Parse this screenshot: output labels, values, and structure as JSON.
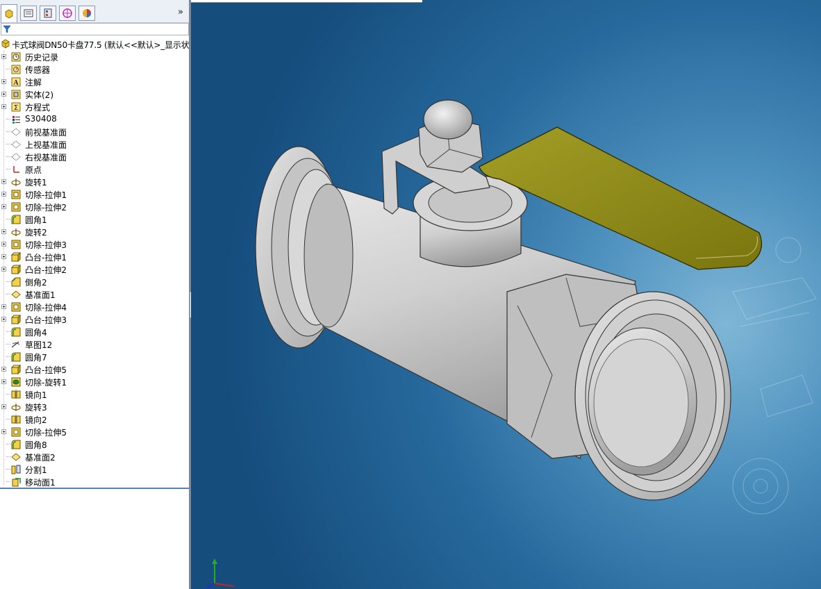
{
  "feature_manager": {
    "tabs": [
      {
        "name": "featuremanager-tab",
        "active": true
      },
      {
        "name": "propertymanager-tab",
        "active": false
      },
      {
        "name": "configurationmanager-tab",
        "active": false
      },
      {
        "name": "dimxpertmanager-tab",
        "active": false
      },
      {
        "name": "displaymanager-tab",
        "active": false
      }
    ],
    "expand_label": "»",
    "root_label": "卡式球阀DN50卡盘77.5  (默认<<默认>_显示状",
    "items": [
      {
        "label": "历史记录",
        "icon": "history-icon",
        "expandable": true
      },
      {
        "label": "传感器",
        "icon": "sensor-icon",
        "expandable": false
      },
      {
        "label": "注解",
        "icon": "annotation-icon",
        "expandable": true
      },
      {
        "label": "实体(2)",
        "icon": "solid-bodies-icon",
        "expandable": true
      },
      {
        "label": "方程式",
        "icon": "equations-icon",
        "expandable": true
      },
      {
        "label": "S30408",
        "icon": "material-icon",
        "expandable": false
      },
      {
        "label": "前视基准面",
        "icon": "plane-icon",
        "expandable": false
      },
      {
        "label": "上视基准面",
        "icon": "plane-icon",
        "expandable": false
      },
      {
        "label": "右视基准面",
        "icon": "plane-icon",
        "expandable": false
      },
      {
        "label": "原点",
        "icon": "origin-icon",
        "expandable": false
      },
      {
        "label": "旋转1",
        "icon": "revolve-icon",
        "expandable": true
      },
      {
        "label": "切除-拉伸1",
        "icon": "cut-extrude-icon",
        "expandable": true
      },
      {
        "label": "切除-拉伸2",
        "icon": "cut-extrude-icon",
        "expandable": true
      },
      {
        "label": "圆角1",
        "icon": "fillet-icon",
        "expandable": false
      },
      {
        "label": "旋转2",
        "icon": "revolve-icon",
        "expandable": true
      },
      {
        "label": "切除-拉伸3",
        "icon": "cut-extrude-icon",
        "expandable": true
      },
      {
        "label": "凸台-拉伸1",
        "icon": "boss-extrude-icon",
        "expandable": true
      },
      {
        "label": "凸台-拉伸2",
        "icon": "boss-extrude-icon",
        "expandable": true
      },
      {
        "label": "倒角2",
        "icon": "chamfer-icon",
        "expandable": false
      },
      {
        "label": "基准面1",
        "icon": "ref-plane-icon",
        "expandable": false
      },
      {
        "label": "切除-拉伸4",
        "icon": "cut-extrude-icon",
        "expandable": true
      },
      {
        "label": "凸台-拉伸3",
        "icon": "boss-extrude-icon",
        "expandable": true
      },
      {
        "label": "圆角4",
        "icon": "fillet-icon",
        "expandable": false
      },
      {
        "label": "草图12",
        "icon": "sketch-icon",
        "expandable": false
      },
      {
        "label": "圆角7",
        "icon": "fillet-icon",
        "expandable": false
      },
      {
        "label": "凸台-拉伸5",
        "icon": "boss-extrude-icon",
        "expandable": true
      },
      {
        "label": "切除-旋转1",
        "icon": "cut-revolve-icon",
        "expandable": true
      },
      {
        "label": "镜向1",
        "icon": "mirror-icon",
        "expandable": false
      },
      {
        "label": "旋转3",
        "icon": "revolve-icon",
        "expandable": true
      },
      {
        "label": "镜向2",
        "icon": "mirror-icon",
        "expandable": false
      },
      {
        "label": "切除-拉伸5",
        "icon": "cut-extrude-icon",
        "expandable": true
      },
      {
        "label": "圆角8",
        "icon": "fillet-icon",
        "expandable": false
      },
      {
        "label": "基准面2",
        "icon": "ref-plane-icon",
        "expandable": false
      },
      {
        "label": "分割1",
        "icon": "split-icon",
        "expandable": false
      },
      {
        "label": "移动面1",
        "icon": "move-face-icon",
        "expandable": false
      }
    ]
  },
  "viewport": {
    "model": "ball-valve-3d-model",
    "handle_color": "#8f8a18",
    "body_color": "#c8c8c8"
  }
}
